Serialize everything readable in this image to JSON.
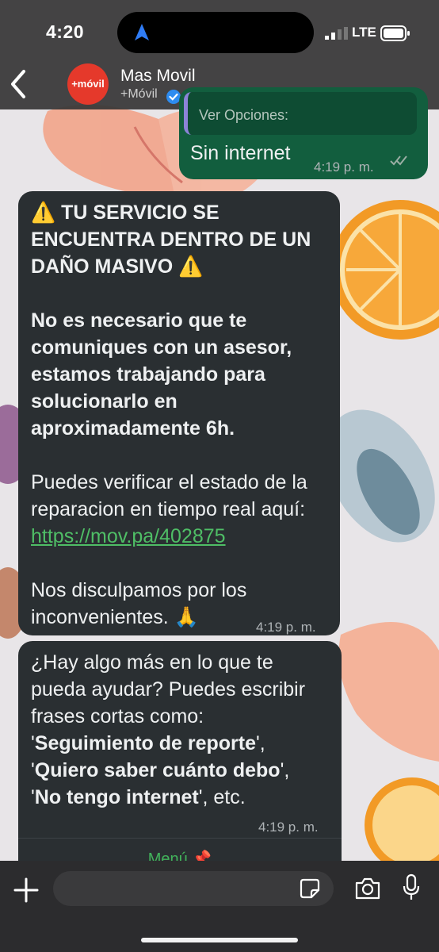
{
  "status_bar": {
    "time": "4:20",
    "network": "LTE"
  },
  "header": {
    "avatar_text": "+móvil",
    "name": "Mas Movil",
    "subtitle": "+Móvil"
  },
  "messages": [
    {
      "direction": "outgoing",
      "quoted": "Ver Opciones:",
      "text": "Sin internet",
      "time": "4:19 p. m."
    },
    {
      "direction": "incoming",
      "lines": [
        "⚠️ TU SERVICIO SE",
        "ENCUENTRA DENTRO DE UN",
        "DAÑO MASIVO ⚠️",
        "No es necesario que te",
        "comuniques con un asesor,",
        "estamos trabajando para",
        "solucionarlo en",
        "aproximadamente 6h.",
        "Puedes verificar el estado de la",
        "reparacion en tiempo real aquí:",
        "https://mov.pa/402875",
        "Nos disculpamos por los",
        "inconvenientes. 🙏"
      ],
      "time": "4:19 p. m."
    },
    {
      "direction": "incoming",
      "lines": [
        "¿Hay algo más en lo que te",
        "pueda ayudar? Puedes escribir",
        "frases cortas como:",
        "'Seguimiento de reporte',",
        "'Quiero saber cuánto debo',",
        "'No tengo internet', etc."
      ],
      "bold_parts": [
        "Seguimiento de reporte",
        "Quiero saber cuánto debo",
        "No tengo internet"
      ],
      "time": "4:19 p. m.",
      "button": "Menú 📌"
    }
  ],
  "composer": {
    "placeholder": ""
  },
  "colors": {
    "header_bg": "#373737",
    "incoming_bubble": "#2a2f32",
    "outgoing_bubble": "#125e3e",
    "link": "#4fbe66",
    "brand": "#e5392b",
    "verified": "#2d8cf0"
  }
}
